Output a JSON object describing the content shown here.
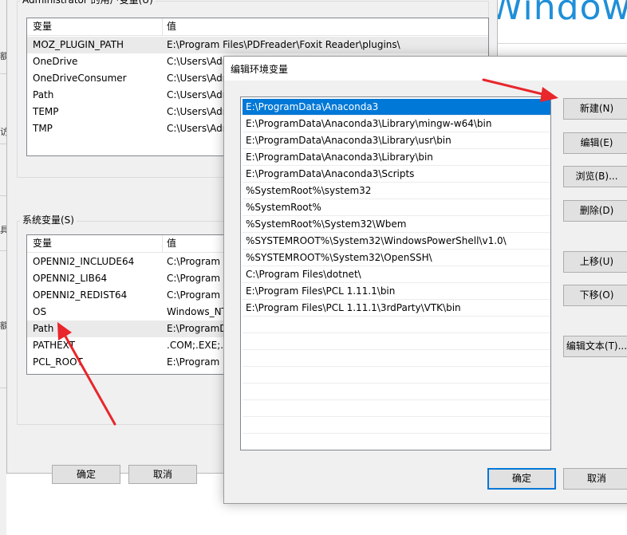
{
  "background": {
    "logo_text": "Windows",
    "left_fragments": [
      "额",
      "访",
      "具",
      "额"
    ]
  },
  "env_dialog": {
    "user_vars_label": "Administrator 的用户变量(U)",
    "system_vars_label": "系统变量(S)",
    "columns": {
      "variable": "变量",
      "value": "值"
    },
    "user_vars": [
      {
        "name": "MOZ_PLUGIN_PATH",
        "value": "E:\\Program Files\\PDFreader\\Foxit Reader\\plugins\\"
      },
      {
        "name": "OneDrive",
        "value": "C:\\Users\\Adr"
      },
      {
        "name": "OneDriveConsumer",
        "value": "C:\\Users\\Adr"
      },
      {
        "name": "Path",
        "value": "C:\\Users\\Adr"
      },
      {
        "name": "TEMP",
        "value": "C:\\Users\\Adr"
      },
      {
        "name": "TMP",
        "value": "C:\\Users\\Adr"
      }
    ],
    "system_vars": [
      {
        "name": "OPENNI2_INCLUDE64",
        "value": "C:\\Program"
      },
      {
        "name": "OPENNI2_LIB64",
        "value": "C:\\Program"
      },
      {
        "name": "OPENNI2_REDIST64",
        "value": "C:\\Program"
      },
      {
        "name": "OS",
        "value": "Windows_NT"
      },
      {
        "name": "Path",
        "value": "E:\\ProgramD"
      },
      {
        "name": "PATHEXT",
        "value": ".COM;.EXE;.B"
      },
      {
        "name": "PCL_ROOT",
        "value": "E:\\Program"
      }
    ],
    "ok_label": "确定",
    "cancel_label": "取消"
  },
  "edit_dialog": {
    "title": "编辑环境变量",
    "close_glyph": "×",
    "paths": [
      "E:\\ProgramData\\Anaconda3",
      "E:\\ProgramData\\Anaconda3\\Library\\mingw-w64\\bin",
      "E:\\ProgramData\\Anaconda3\\Library\\usr\\bin",
      "E:\\ProgramData\\Anaconda3\\Library\\bin",
      "E:\\ProgramData\\Anaconda3\\Scripts",
      "%SystemRoot%\\system32",
      "%SystemRoot%",
      "%SystemRoot%\\System32\\Wbem",
      "%SYSTEMROOT%\\System32\\WindowsPowerShell\\v1.0\\",
      "%SYSTEMROOT%\\System32\\OpenSSH\\",
      "C:\\Program Files\\dotnet\\",
      "E:\\Program Files\\PCL 1.11.1\\bin",
      "E:\\Program Files\\PCL 1.11.1\\3rdParty\\VTK\\bin"
    ],
    "selected_index": 0,
    "buttons": {
      "new": "新建(N)",
      "edit": "编辑(E)",
      "browse": "浏览(B)...",
      "delete": "删除(D)",
      "move_up": "上移(U)",
      "move_down": "下移(O)",
      "edit_text": "编辑文本(T)...",
      "ok": "确定",
      "cancel": "取消"
    }
  },
  "colors": {
    "selection": "#0078d7",
    "annotation_arrow": "#e8262b",
    "logo": "#1f8fd8"
  }
}
